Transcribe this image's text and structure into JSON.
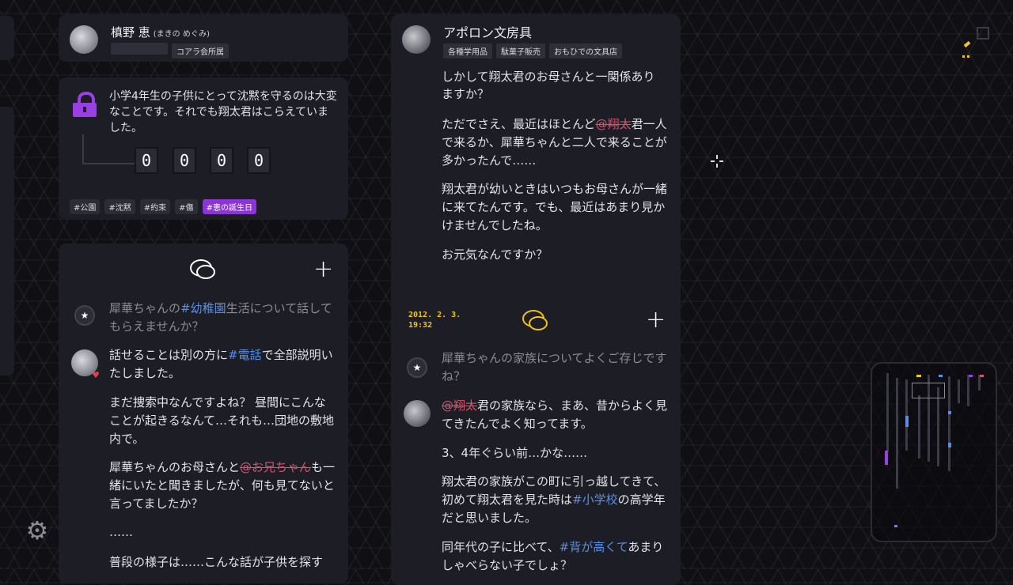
{
  "left_profile": {
    "name": "槙野 恵",
    "reading": "(まきの めぐみ)",
    "tags": [
      "",
      "コアラ会所属"
    ]
  },
  "right_profile": {
    "name": "アポロン文房具",
    "tags": [
      "各種学用品",
      "駄菓子販売",
      "おもひでの文具店"
    ]
  },
  "puzzle": {
    "text": "小学4年生の子供にとって沈黙を守るのは大変なことです。それでも翔太君はこらえていました。",
    "digits": [
      "0",
      "0",
      "0",
      "0"
    ],
    "hashtags": [
      "#公園",
      "#沈黙",
      "#約束",
      "#傷",
      "#恵の誕生日"
    ]
  },
  "left_chat": {
    "q1_pre": "犀華ちゃんの",
    "q1_link": "#幼稚園",
    "q1_post": "生活について話してもらえませんか？",
    "a1_pre": "話せることは別の方に",
    "a1_link": "#電話",
    "a1_post": "で全部説明いたしました。",
    "p2": "まだ捜索中なんですよね？ 昼間にこんなことが起きるなんて…それも…団地の敷地内で。",
    "p3_pre": "犀華ちゃんのお母さんと",
    "p3_link": "@お兄ちゃん",
    "p3_post": "も一緒にいたと聞きましたが、何も見てないと言ってましたか？",
    "p4": "……",
    "p5": "普段の様子は……こんな話が子供を探す"
  },
  "right_chat": {
    "top_fragment": "しかして翔太君のお母さんと一関係あり",
    "top_line2": "ますか？",
    "p1_pre": "ただでさえ、最近はほとんど",
    "p1_link": "@翔太",
    "p1_post": "君一人で来るか、犀華ちゃんと二人で来ることが多かったんで……",
    "p2": "翔太君が幼いときはいつもお母さんが一緒に来てたんです。でも、最近はあまり見かけませんでしたね。",
    "p3": "お元気なんですか？",
    "date": "2012. 2. 3.",
    "time": "19:32",
    "q2": "犀華ちゃんの家族についてよくご存じですね？",
    "a2_link": "@翔太",
    "a2_post": "君の家族なら、まあ、昔からよく見てきたんでよく知ってます。",
    "p4": "3、4年ぐらい前…かな……",
    "p5_pre": "翔太君の家族がこの町に引っ越してきて、初めて翔太君を見た時は",
    "p5_link": "#小学校",
    "p5_post": "の高学年だと思いました。",
    "p6_pre": "同年代の子に比べて、",
    "p6_link": "#背が高くて",
    "p6_post": "あまりしゃべらない子でしょ？"
  },
  "colors": {
    "accent_purple": "#8a35d4",
    "accent_yellow": "#f2c318",
    "link_blue": "#5a8ee0",
    "mention_red": "#d1566e"
  }
}
